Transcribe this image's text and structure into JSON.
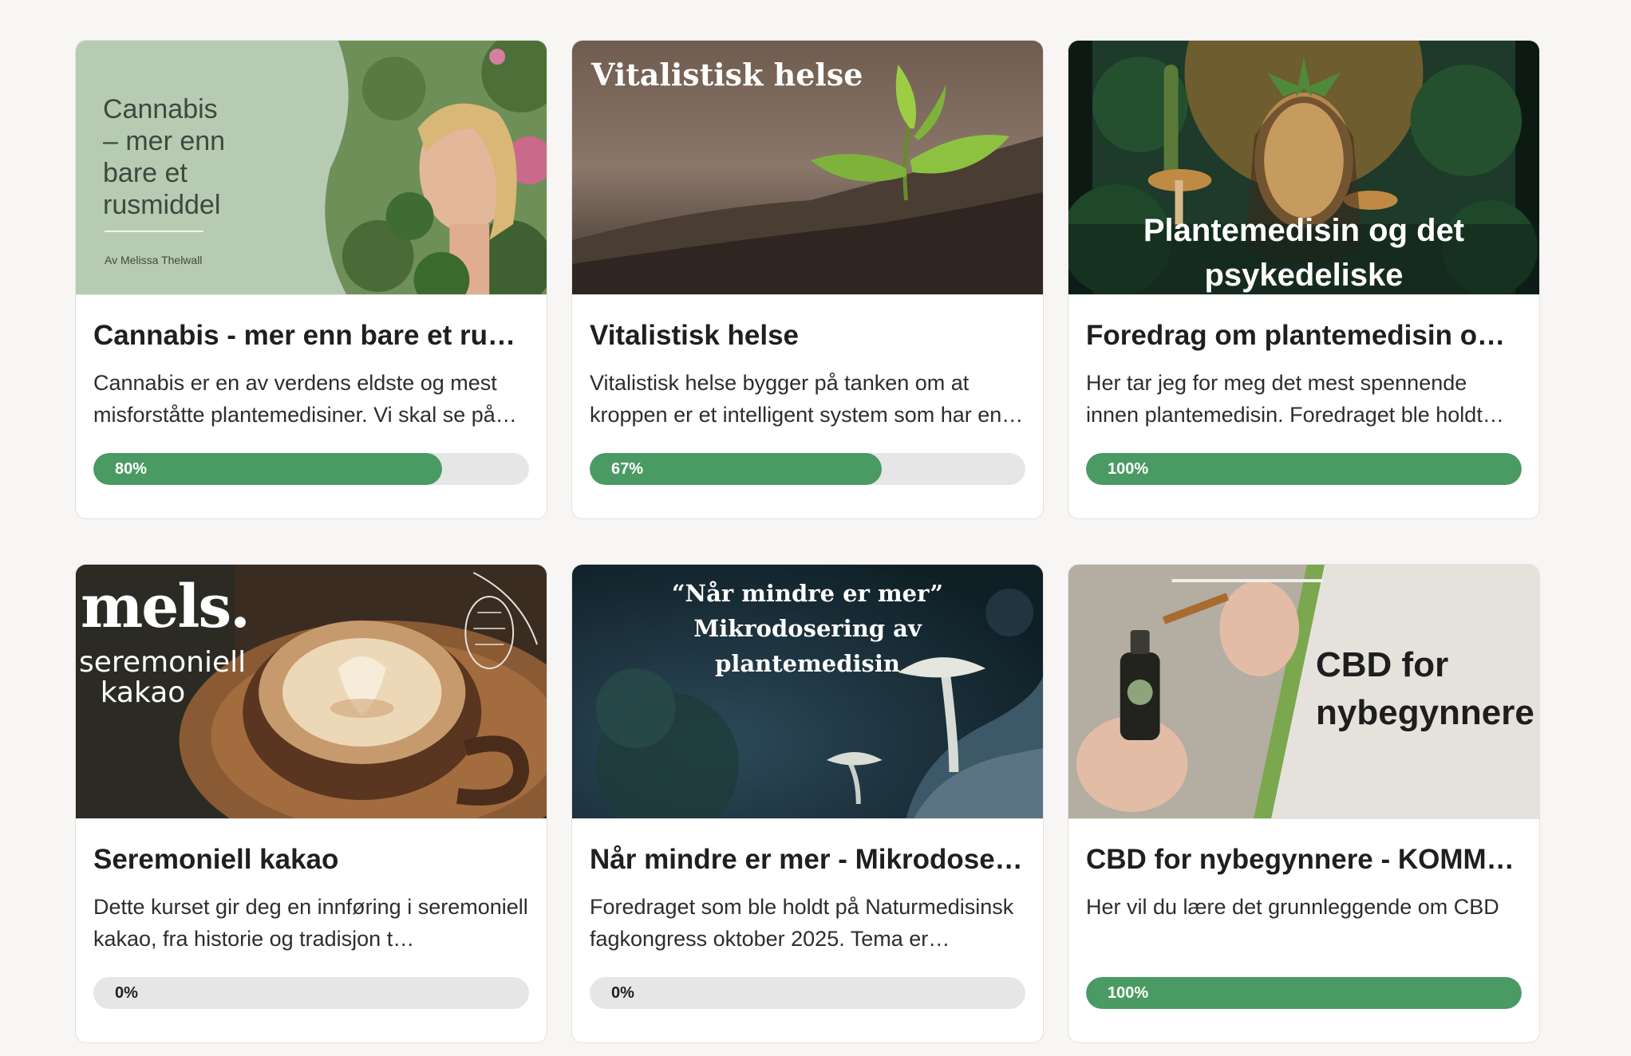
{
  "courses": [
    {
      "title": "Cannabis - mer enn bare et rusmi…",
      "description": "Cannabis er en av verdens eldste og mest misforståtte plantemedisiner. Vi skal se på…",
      "progress_label": "80%",
      "progress": 80,
      "thumb": {
        "title": "Cannabis – mer enn bare et rusmiddel",
        "author": "Av Melissa Thelwall"
      }
    },
    {
      "title": "Vitalistisk helse",
      "description": "Vitalistisk helse bygger på tanken om at kroppen er et intelligent system som har en…",
      "progress_label": "67%",
      "progress": 67,
      "thumb": {
        "title": "Vitalistisk helse"
      }
    },
    {
      "title": "Foredrag om plantemedisin og de…",
      "description": "Her tar jeg for meg det mest spennende innen plantemedisin. Foredraget ble holdt p…",
      "progress_label": "100%",
      "progress": 100,
      "thumb": {
        "title": "Plantemedisin og det psykedeliske"
      }
    },
    {
      "title": "Seremoniell kakao",
      "description": "Dette kurset gir deg en innføring i seremoniell kakao, fra historie og tradisjon t…",
      "progress_label": "0%",
      "progress": 0,
      "thumb": {
        "brand": "mels.",
        "subtitle": "seremoniell kakao"
      }
    },
    {
      "title": "Når mindre er mer - Mikrodoserin…",
      "description": "Foredraget som ble holdt på Naturmedisinsk fagkongress oktober 2025. Tema er…",
      "progress_label": "0%",
      "progress": 0,
      "thumb": {
        "title": "“Når mindre er mer” Mikrodosering av plantemedisin"
      }
    },
    {
      "title": "CBD for nybegynnere - KOMMER!",
      "description": "Her vil du lære det grunnleggende om CBD",
      "progress_label": "100%",
      "progress": 100,
      "thumb": {
        "title": "CBD for nybegynnere"
      }
    }
  ],
  "colors": {
    "progress_fill": "#4a9a63",
    "progress_track": "#e6e6e6",
    "page_background": "#f7f6f4"
  }
}
